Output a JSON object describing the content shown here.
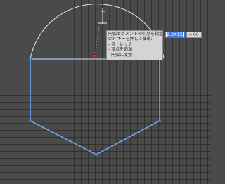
{
  "tooltip": {
    "lines": [
      "円弧セグメントの中点を指定:",
      "Ctrl キーを押して循環:",
      "- ストレッチ",
      "- 頂点を追加",
      "- 円弧に変換"
    ]
  },
  "input": {
    "angle_value": "2.2415",
    "sides_value": "< 60"
  },
  "colors": {
    "background": "#4a4a4a",
    "grid_line": "#2f2f2f",
    "polygon_edge": "#6fa8f0",
    "vertex_grip": "#3f7fe6",
    "arc": "#e8e8e8",
    "midpoint_marker": "#d01818",
    "tooltip_bg": "#d4d4d4",
    "input_highlight": "#3b7ff1"
  }
}
